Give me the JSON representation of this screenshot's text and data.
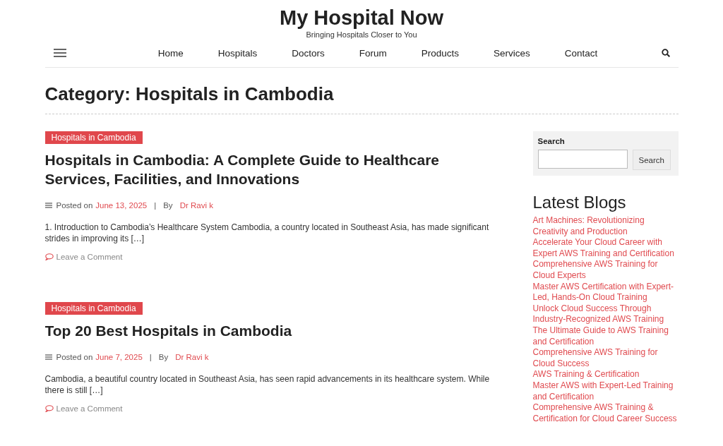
{
  "site": {
    "title": "My Hospital Now",
    "tagline": "Bringing Hospitals Closer to You"
  },
  "nav": {
    "items": [
      {
        "label": "Home",
        "selected": false
      },
      {
        "label": "Hospitals",
        "selected": false
      },
      {
        "label": "Doctors",
        "selected": false
      },
      {
        "label": "Forum",
        "selected": false
      },
      {
        "label": "Products",
        "selected": false
      },
      {
        "label": "Services",
        "selected": false
      },
      {
        "label": "Contact",
        "selected": false
      }
    ]
  },
  "page_title": "Category: Hospitals in Cambodia",
  "posts": [
    {
      "category": "Hospitals in Cambodia",
      "title": "Hospitals in Cambodia: A Complete Guide to Healthcare Services, Facilities, and Innovations",
      "posted_label": "Posted on",
      "date": "June 13, 2025",
      "separator": "|",
      "by_label": "By",
      "author": "Dr Ravi k",
      "excerpt": "1. Introduction to Cambodia’s Healthcare System Cambodia, a country located in Southeast Asia, has made significant strides in improving its […]",
      "comment_link": "Leave a Comment"
    },
    {
      "category": "Hospitals in Cambodia",
      "title": "Top 20 Best Hospitals in Cambodia",
      "posted_label": "Posted on",
      "date": "June 7, 2025",
      "separator": "|",
      "by_label": "By",
      "author": "Dr Ravi k",
      "excerpt": "Cambodia, a beautiful country located in Southeast Asia, has seen rapid advancements in its healthcare system. While there is still […]",
      "comment_link": "Leave a Comment"
    }
  ],
  "sidebar": {
    "search": {
      "label": "Search",
      "button": "Search"
    },
    "latest_blogs": {
      "heading": "Latest Blogs",
      "items": [
        "Art Machines: Revolutionizing Creativity and Production",
        "Accelerate Your Cloud Career with Expert AWS Training and Certification",
        "Comprehensive AWS Training for Cloud Experts",
        "Master AWS Certification with Expert-Led, Hands-On Cloud Training",
        "Unlock Cloud Success Through Industry-Recognized AWS Training",
        "The Ultimate Guide to AWS Training and Certification",
        "Comprehensive AWS Training for Cloud Success",
        "AWS Training & Certification",
        "Master AWS with Expert-Led Training and Certification",
        "Comprehensive AWS Training & Certification for Cloud Career Success"
      ]
    }
  }
}
